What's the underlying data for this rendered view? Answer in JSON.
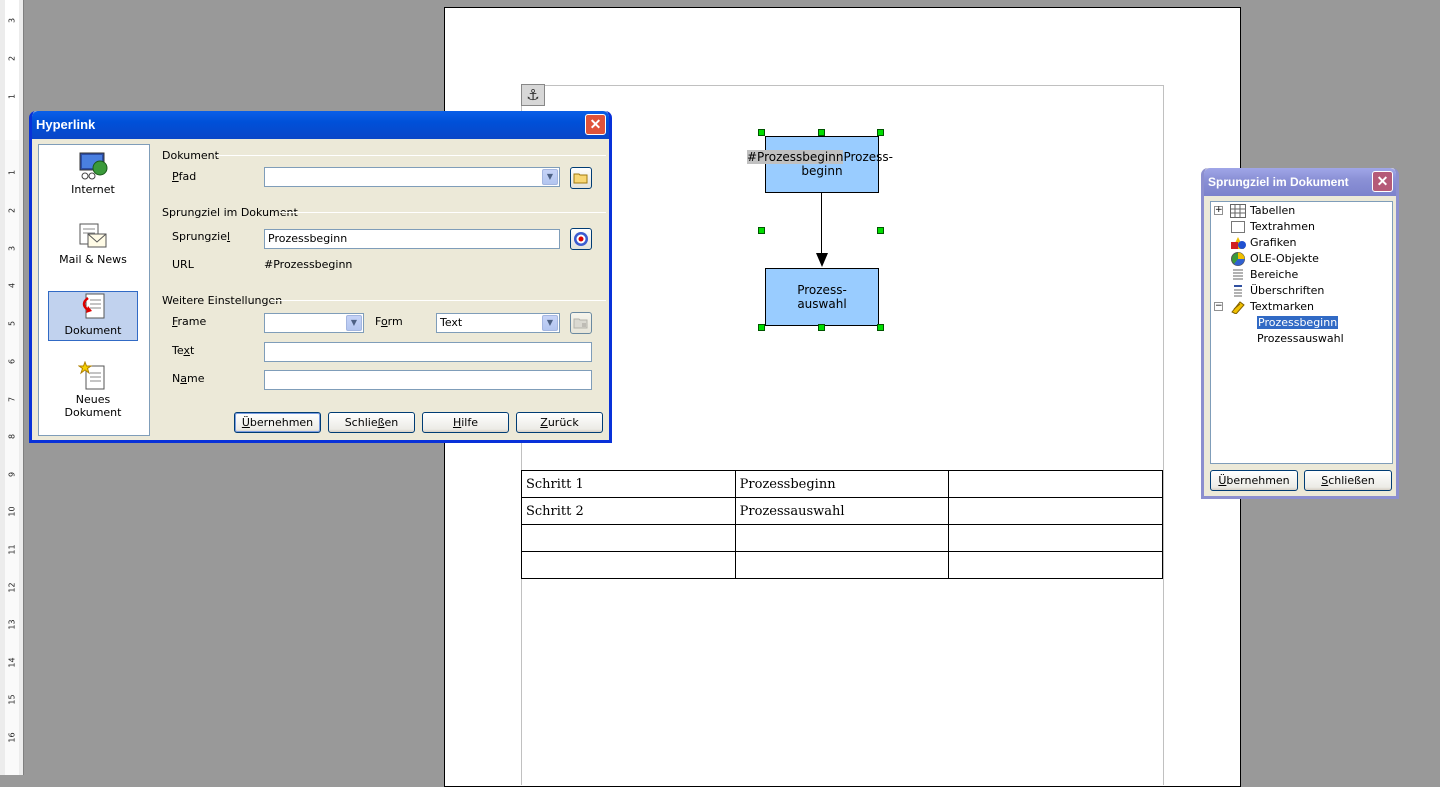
{
  "ruler": {
    "labels": [
      "3",
      "2",
      "1",
      "1",
      "2",
      "3",
      "4",
      "5",
      "6",
      "7",
      "8",
      "9",
      "10",
      "11",
      "12",
      "13",
      "14",
      "15",
      "16"
    ]
  },
  "document": {
    "anchor_symbol": "⚓",
    "shape1": {
      "prefix": "#Prozessbeginn",
      "suffix": "Prozess-",
      "line2": "beginn"
    },
    "shape2": {
      "line1": "Prozess-",
      "line2": "auswahl"
    },
    "table": [
      [
        "Schritt 1",
        "Prozessbeginn",
        ""
      ],
      [
        "Schritt 2",
        "Prozessauswahl",
        ""
      ],
      [
        "",
        "",
        ""
      ],
      [
        "",
        "",
        ""
      ]
    ]
  },
  "hyperlink_dialog": {
    "title": "Hyperlink",
    "close_symbol": "✕",
    "nav": [
      {
        "label": "Internet",
        "icon": "internet-icon"
      },
      {
        "label": "Mail & News",
        "icon": "mail-news-icon"
      },
      {
        "label": "Dokument",
        "icon": "document-link-icon",
        "selected": true
      },
      {
        "label": "Neues Dokument",
        "icon": "new-document-icon"
      }
    ],
    "section_document": "Dokument",
    "path_label_u": "P",
    "path_label_rest": "fad",
    "path_value": "",
    "section_target": "Sprungziel im Dokument",
    "target_label_pre": "Sprungzie",
    "target_label_u": "l",
    "target_value": "Prozessbeginn",
    "url_label": "URL",
    "url_value": "#Prozessbeginn",
    "section_more": "Weitere Einstellungen",
    "frame_label_u": "F",
    "frame_label_rest": "rame",
    "frame_value": "",
    "form_label_pre": "F",
    "form_label_u": "o",
    "form_label_rest": "rm",
    "form_value": "Text",
    "text_label_pre": "Te",
    "text_label_u": "x",
    "text_label_rest": "t",
    "text_value": "",
    "name_label_pre": "N",
    "name_label_u": "a",
    "name_label_rest": "me",
    "name_value": "",
    "buttons": {
      "apply_u": "Ü",
      "apply_rest": "bernehmen",
      "close_pre": "Schlie",
      "close_u": "ß",
      "close_rest": "en",
      "help_u": "H",
      "help_rest": "ilfe",
      "back_u": "Z",
      "back_rest": "urück"
    }
  },
  "navigator_dialog": {
    "title": "Sprungziel im Dokument",
    "close_symbol": "✕",
    "tree": [
      {
        "label": "Tabellen",
        "icon": "table-icon",
        "expander": "+"
      },
      {
        "label": "Textrahmen",
        "icon": "text-frame-icon"
      },
      {
        "label": "Grafiken",
        "icon": "graphics-icon"
      },
      {
        "label": "OLE-Objekte",
        "icon": "ole-object-icon"
      },
      {
        "label": "Bereiche",
        "icon": "sections-icon"
      },
      {
        "label": "Überschriften",
        "icon": "headings-icon"
      },
      {
        "label": "Textmarken",
        "icon": "bookmark-icon",
        "expander": "−"
      }
    ],
    "bookmarks": [
      {
        "label": "Prozessbeginn",
        "selected": true
      },
      {
        "label": "Prozessauswahl"
      }
    ],
    "apply_u": "Ü",
    "apply_rest": "bernehmen",
    "close_u": "S",
    "close_rest": "chließen"
  }
}
